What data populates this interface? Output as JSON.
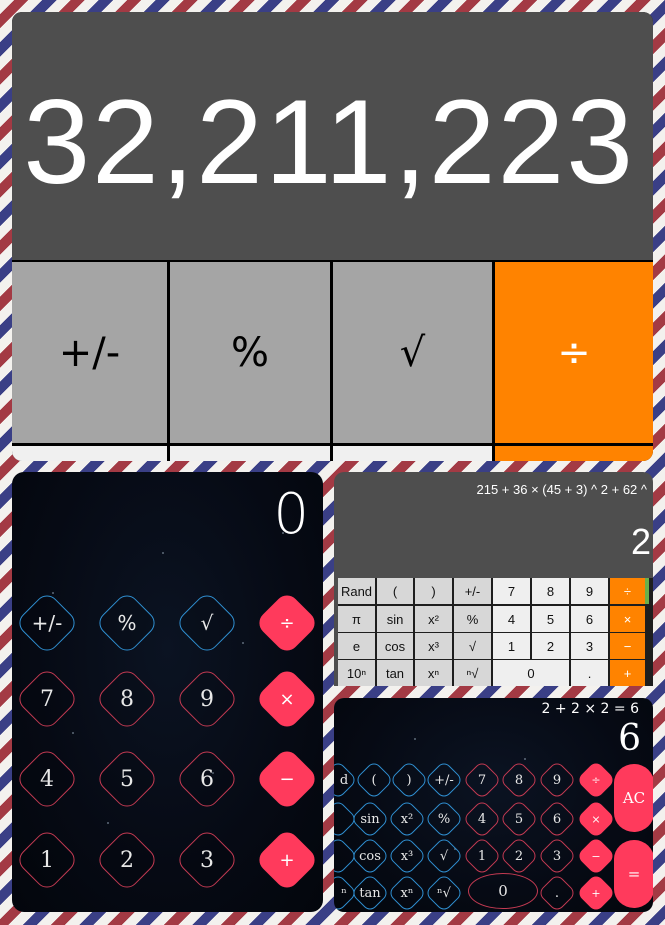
{
  "top_calc": {
    "display": "32,211,223",
    "keys": [
      "+/-",
      "%",
      "√",
      "÷"
    ]
  },
  "starry_calc": {
    "display": "0",
    "keys": {
      "row1": [
        "+/-",
        "%",
        "√",
        "÷"
      ],
      "row2": [
        "7",
        "8",
        "9",
        "×"
      ],
      "row3": [
        "4",
        "5",
        "6",
        "−"
      ],
      "row4": [
        "1",
        "2",
        "3",
        "+"
      ]
    }
  },
  "sci_calc": {
    "expression": "215 + 36 × (45 + 3) ^ 2 + 62 ^",
    "result": "2",
    "rows": [
      [
        "Rand",
        "(",
        ")",
        "+/-",
        "7",
        "8",
        "9",
        "÷"
      ],
      [
        "π",
        "sin",
        "x²",
        "%",
        "4",
        "5",
        "6",
        "×"
      ],
      [
        "e",
        "cos",
        "x³",
        "√",
        "1",
        "2",
        "3",
        "−"
      ],
      [
        "10ⁿ",
        "tan",
        "xⁿ",
        "ⁿ√",
        "0",
        ".",
        "+"
      ]
    ]
  },
  "starry_sci_calc": {
    "expression": "2 + 2 × 2 = 6",
    "result": "6",
    "rows": [
      [
        "d",
        "(",
        ")",
        "+/-",
        "7",
        "8",
        "9",
        "÷"
      ],
      [
        "",
        "sin",
        "x²",
        "%",
        "4",
        "5",
        "6",
        "×"
      ],
      [
        "",
        "cos",
        "x³",
        "√",
        "1",
        "2",
        "3",
        "−"
      ],
      [
        "ⁿ",
        "tan",
        "xⁿ",
        "ⁿ√",
        "0",
        ".",
        "+"
      ]
    ],
    "ac_label": "AC",
    "equals_label": "="
  }
}
